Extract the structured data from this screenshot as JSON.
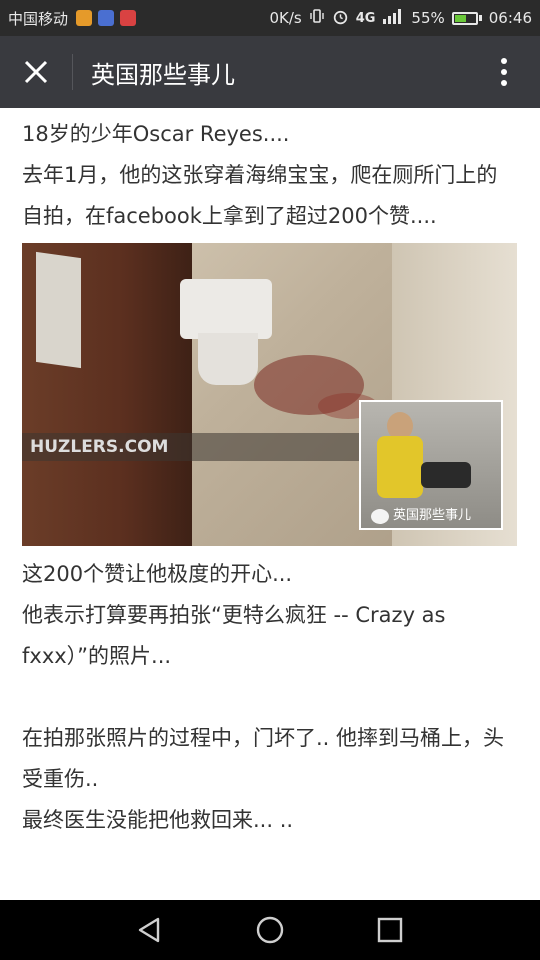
{
  "status_bar": {
    "carrier": "中国移动",
    "net_speed": "0K/s",
    "network": "4G",
    "battery_percent": "55%",
    "battery_level": 0.55,
    "time": "06:46"
  },
  "header": {
    "title": "英国那些事儿"
  },
  "article": {
    "p1": "18岁的少年Oscar Reyes....",
    "p2": "去年1月，他的这张穿着海绵宝宝，爬在厕所门上的自拍，在facebook上拿到了超过200个赞....",
    "image": {
      "watermark": "HUZLERS.COM",
      "inset_caption": "英国那些事儿"
    },
    "p3": "这200个赞让他极度的开心...",
    "p4": "他表示打算要再拍张“更特么疯狂 -- Crazy as fxxx）”的照片...",
    "p5": "在拍那张照片的过程中，门坏了.. 他摔到马桶上，头受重伤..",
    "p6": "最终医生没能把他救回来... .."
  },
  "colors": {
    "status_bg": "#2b2b2b",
    "title_bg": "#393a3f",
    "text": "#333333",
    "nav_bg": "#000000"
  }
}
